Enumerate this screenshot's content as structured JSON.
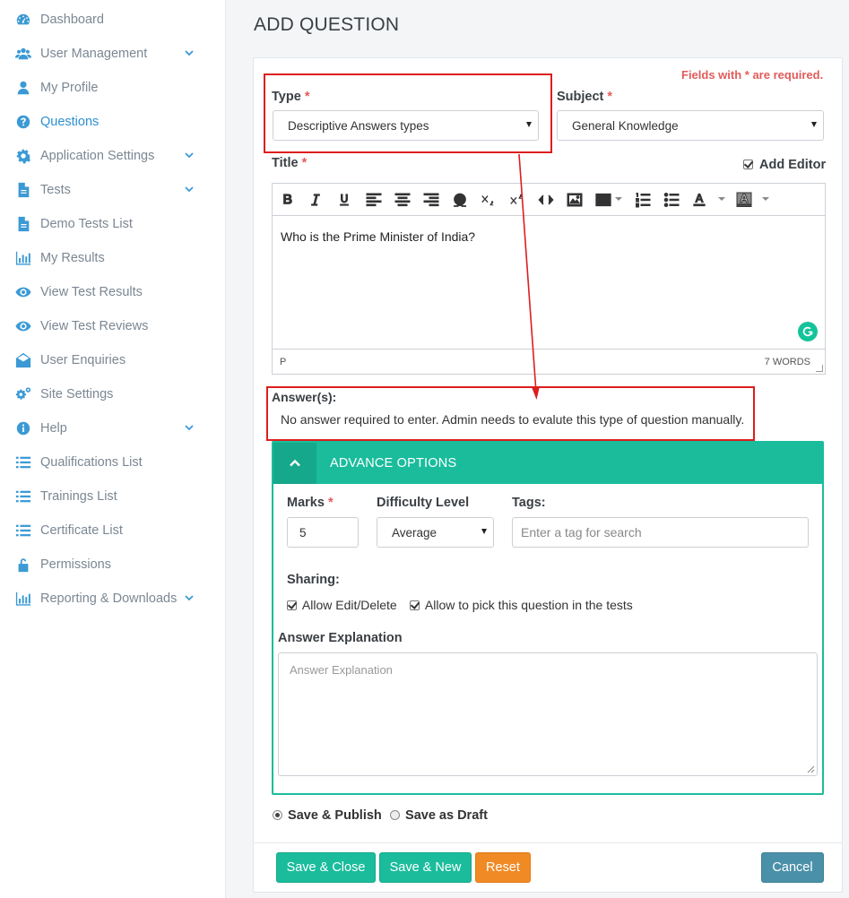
{
  "sidebar": {
    "items": [
      {
        "label": "Dashboard",
        "icon": "dashboard-icon"
      },
      {
        "label": "User Management",
        "icon": "users-icon",
        "has_submenu": true
      },
      {
        "label": "My Profile",
        "icon": "user-icon"
      },
      {
        "label": "Questions",
        "icon": "question-circle-icon",
        "active": true
      },
      {
        "label": "Application Settings",
        "icon": "gear-icon",
        "has_submenu": true
      },
      {
        "label": "Tests",
        "icon": "file-icon",
        "has_submenu": true
      },
      {
        "label": "Demo Tests List",
        "icon": "file-icon"
      },
      {
        "label": "My Results",
        "icon": "bar-chart-icon"
      },
      {
        "label": "View Test Results",
        "icon": "eye-icon"
      },
      {
        "label": "View Test Reviews",
        "icon": "eye-icon"
      },
      {
        "label": "User Enquiries",
        "icon": "envelope-open-icon"
      },
      {
        "label": "Site Settings",
        "icon": "gears-icon"
      },
      {
        "label": "Help",
        "icon": "info-circle-icon",
        "has_submenu": true
      },
      {
        "label": "Qualifications List",
        "icon": "list-icon"
      },
      {
        "label": "Trainings List",
        "icon": "list-icon"
      },
      {
        "label": "Certificate List",
        "icon": "list-icon"
      },
      {
        "label": "Permissions",
        "icon": "unlock-icon"
      },
      {
        "label": "Reporting & Downloads",
        "icon": "bar-chart-icon",
        "has_submenu": true
      }
    ]
  },
  "page": {
    "title": "ADD QUESTION",
    "required_note": "Fields with * are required."
  },
  "form": {
    "type": {
      "label": "Type",
      "value": "Descriptive Answers types"
    },
    "subject": {
      "label": "Subject",
      "value": "General Knowledge"
    },
    "title": {
      "label": "Title"
    },
    "add_editor": {
      "label": "Add Editor",
      "checked": true
    },
    "editor": {
      "content": "Who is the Prime Minister of India?",
      "status_path": "P",
      "word_count": "7 WORDS"
    },
    "answers": {
      "label": "Answer(s):",
      "note": "No answer required to enter. Admin needs to evalute this type of question manually."
    },
    "advance": {
      "title": "ADVANCE OPTIONS",
      "marks": {
        "label": "Marks",
        "value": "5"
      },
      "difficulty": {
        "label": "Difficulty Level",
        "value": "Average"
      },
      "tags": {
        "label": "Tags:",
        "placeholder": "Enter a tag for search"
      },
      "sharing": {
        "label": "Sharing:",
        "allow_edit": {
          "label": "Allow Edit/Delete",
          "checked": true
        },
        "allow_pick": {
          "label": "Allow to pick this question in the tests",
          "checked": true
        }
      },
      "explanation": {
        "label": "Answer Explanation",
        "placeholder": "Answer Explanation"
      }
    },
    "publish_options": [
      {
        "label": "Save & Publish",
        "selected": true
      },
      {
        "label": "Save as Draft",
        "selected": false
      }
    ]
  },
  "buttons": {
    "save_close": "Save & Close",
    "save_new": "Save & New",
    "reset": "Reset",
    "cancel": "Cancel"
  },
  "colors": {
    "accent": "#1abc9c",
    "sidebar_icon": "#3b9ad5",
    "required": "#e35b5b",
    "annotation": "#dd1e1e",
    "reset": "#f08a24",
    "cancel": "#4a90a8"
  }
}
